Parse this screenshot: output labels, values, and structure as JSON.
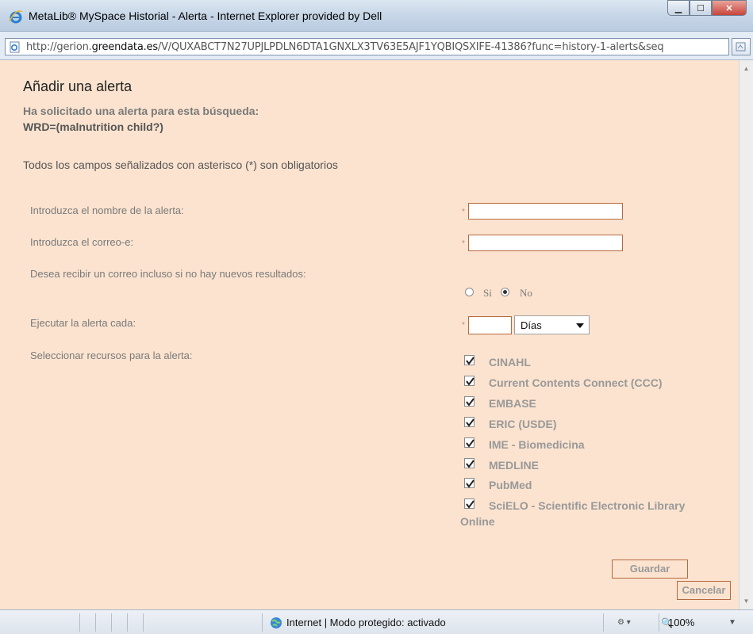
{
  "window": {
    "title": "MetaLib® MySpace Historial - Alerta - Internet Explorer provided by Dell",
    "url_prefix": "http://gerion.",
    "url_domain": "greendata.es",
    "url_rest": "/V/QUXABCT7N27UPJLPDLN6DTA1GNXLX3TV63E5AJF1YQBIQSXIFE-41386?func=history-1-alerts&seq"
  },
  "page": {
    "title": "Añadir una alerta",
    "request_label": "Ha solicitado una alerta para esta búsqueda:",
    "query": "WRD=(malnutrition child?)",
    "mandatory_note": "Todos los campos señalizados con asterisco (*) son obligatorios"
  },
  "form": {
    "star": "*",
    "alert_name_label": "Introduzca el nombre de la alerta:",
    "alert_name_value": "",
    "email_label": "Introduzca el correo-e:",
    "email_value": "",
    "notify_label": "Desea recibir un correo incluso si no hay nuevos resultados:",
    "option_yes": "Si",
    "option_no": "No",
    "selected_option": "No",
    "frequency_label": "Ejecutar la alerta cada:",
    "frequency_value": "",
    "frequency_unit": "Días",
    "resources_label": "Seleccionar recursos para la alerta:",
    "resources": [
      {
        "label": "CINAHL",
        "checked": true
      },
      {
        "label": "Current Contents Connect (CCC)",
        "checked": true
      },
      {
        "label": "EMBASE",
        "checked": true
      },
      {
        "label": "ERIC (USDE)",
        "checked": true
      },
      {
        "label": "IME - Biomedicina",
        "checked": true
      },
      {
        "label": "MEDLINE",
        "checked": true
      },
      {
        "label": "PubMed",
        "checked": true
      },
      {
        "label": "SciELO - Scientific Electronic Library",
        "label_cont": "Online",
        "checked": true
      }
    ],
    "save_label": "Guardar",
    "cancel_label": "Cancelar"
  },
  "statusbar": {
    "zone": "Internet | Modo protegido: activado",
    "zoom": "100%"
  }
}
